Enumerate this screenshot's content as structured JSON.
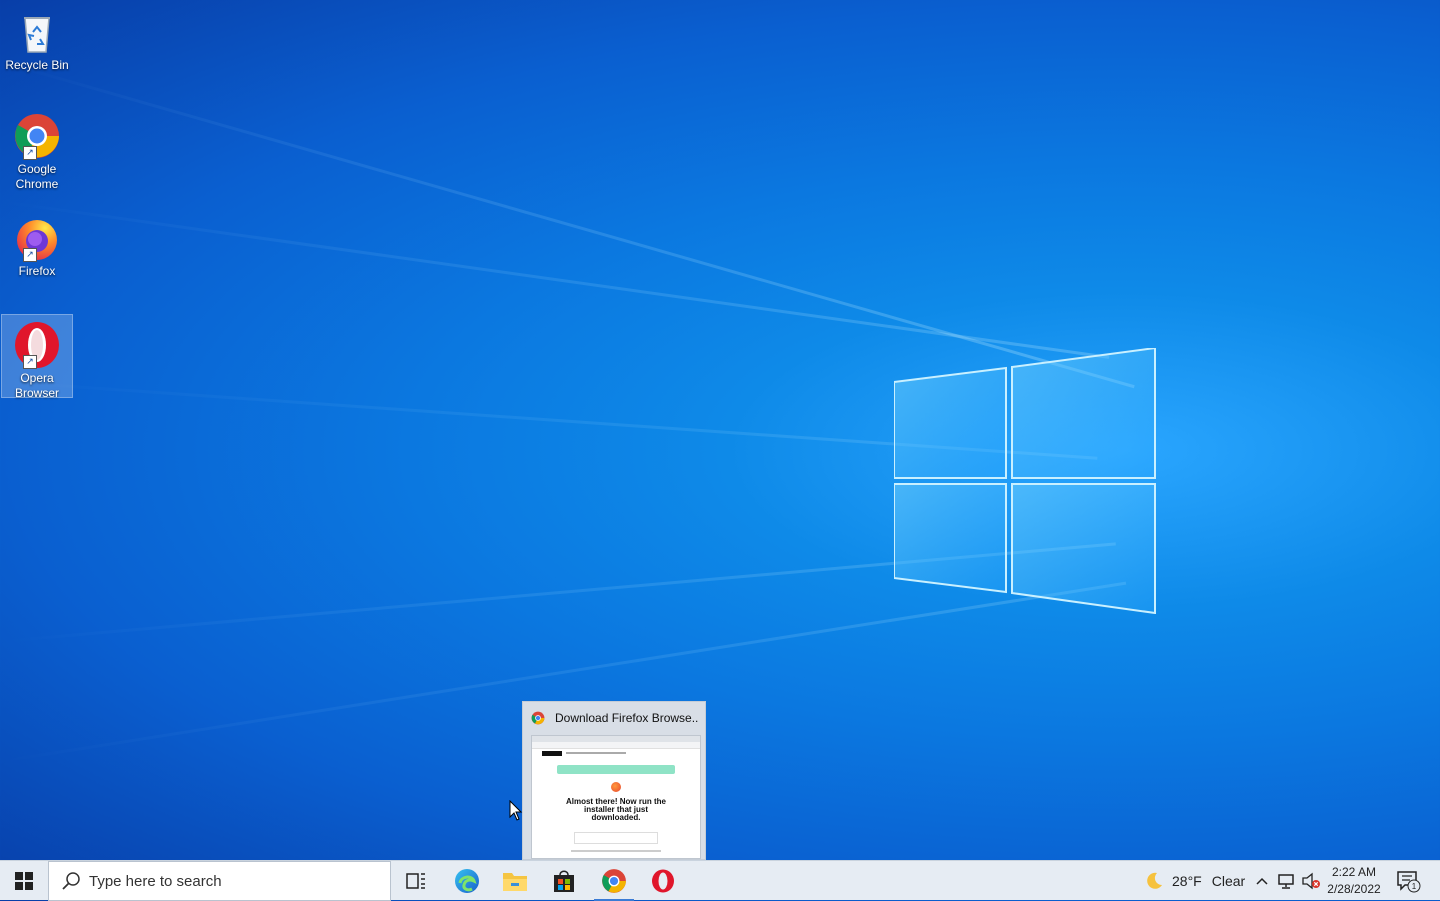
{
  "desktop": {
    "icons": [
      {
        "label": "Recycle Bin"
      },
      {
        "label": "Google Chrome"
      },
      {
        "label": "Firefox"
      },
      {
        "label": "Opera Browser"
      }
    ]
  },
  "preview": {
    "title": "Download Firefox Browse...",
    "content": {
      "message": "Almost there! Now run the installer that just downloaded."
    }
  },
  "taskbar": {
    "search_placeholder": "Type here to search",
    "pinned": [
      "task-view",
      "edge",
      "file-explorer",
      "store",
      "chrome",
      "opera"
    ],
    "active": "chrome",
    "weather": {
      "temp": "28°F",
      "condition": "Clear"
    },
    "clock": {
      "time": "2:22 AM",
      "date": "2/28/2022"
    },
    "notifications": "1"
  },
  "colors": {
    "desktop_blue": "#0b78e0",
    "taskbar_bg": "#e6ecf3",
    "active_indicator": "#3a7bd5"
  }
}
